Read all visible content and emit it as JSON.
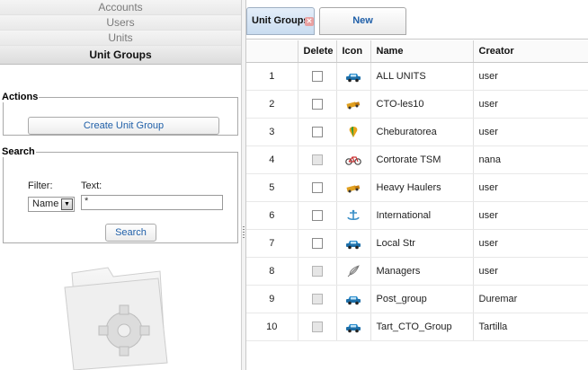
{
  "sidebar": {
    "items": [
      {
        "label": "Accounts"
      },
      {
        "label": "Users"
      },
      {
        "label": "Units"
      },
      {
        "label": "Unit Groups"
      }
    ]
  },
  "actions": {
    "legend": "Actions",
    "create_button": "Create Unit Group"
  },
  "search": {
    "legend": "Search",
    "filter_label": "Filter:",
    "text_label": "Text:",
    "filter_value": "Name",
    "text_value": "*",
    "search_button": "Search"
  },
  "tabs": [
    {
      "label": "Unit Groups"
    },
    {
      "label": "New"
    }
  ],
  "table": {
    "headers": [
      "",
      "Delete",
      "Icon",
      "Name",
      "Creator"
    ],
    "rows": [
      {
        "num": "1",
        "icon": "car-icon",
        "name": "ALL UNITS",
        "creator": "user",
        "checkbox_disabled": false
      },
      {
        "num": "2",
        "icon": "truck-icon",
        "name": "CTO-les10",
        "creator": "user",
        "checkbox_disabled": false
      },
      {
        "num": "3",
        "icon": "map-pin-icon",
        "name": "Cheburatorea",
        "creator": "user",
        "checkbox_disabled": false
      },
      {
        "num": "4",
        "icon": "bicycle-icon",
        "name": "Cortorate TSM",
        "creator": "nana",
        "checkbox_disabled": true
      },
      {
        "num": "5",
        "icon": "truck-icon",
        "name": "Heavy Haulers",
        "creator": "user",
        "checkbox_disabled": false
      },
      {
        "num": "6",
        "icon": "anchor-icon",
        "name": "International",
        "creator": "user",
        "checkbox_disabled": false
      },
      {
        "num": "7",
        "icon": "car-icon",
        "name": "Local Str",
        "creator": "user",
        "checkbox_disabled": false
      },
      {
        "num": "8",
        "icon": "feather-icon",
        "name": "Managers",
        "creator": "user",
        "checkbox_disabled": true
      },
      {
        "num": "9",
        "icon": "car-icon",
        "name": "Post_group",
        "creator": "Duremar",
        "checkbox_disabled": true
      },
      {
        "num": "10",
        "icon": "car-icon",
        "name": "Tart_CTO_Group",
        "creator": "Tartilla",
        "checkbox_disabled": true
      }
    ]
  },
  "colors": {
    "accent_link": "#1f5fa8",
    "active_tab_bg": "#c9dcf0"
  }
}
